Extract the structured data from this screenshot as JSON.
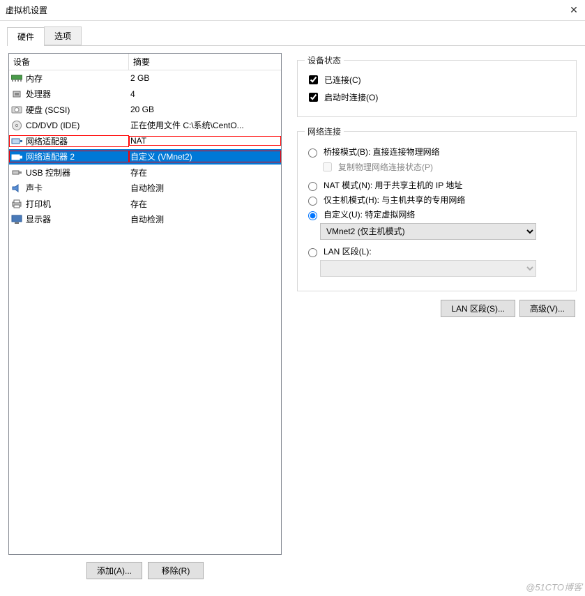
{
  "window": {
    "title": "虚拟机设置",
    "close": "✕"
  },
  "tabs": {
    "hardware": "硬件",
    "options": "选项",
    "active": "hardware"
  },
  "table": {
    "head_device": "设备",
    "head_summary": "摘要",
    "rows": [
      {
        "id": "memory",
        "icon": "memory-icon",
        "label": "内存",
        "summary": "2 GB",
        "selected": false,
        "red": false
      },
      {
        "id": "cpu",
        "icon": "cpu-icon",
        "label": "处理器",
        "summary": "4",
        "selected": false,
        "red": false
      },
      {
        "id": "hdd",
        "icon": "hdd-icon",
        "label": "硬盘 (SCSI)",
        "summary": "20 GB",
        "selected": false,
        "red": false
      },
      {
        "id": "cd",
        "icon": "cd-icon",
        "label": "CD/DVD (IDE)",
        "summary": "正在使用文件 C:\\系统\\CentO...",
        "selected": false,
        "red": false
      },
      {
        "id": "net1",
        "icon": "net-icon",
        "label": "网络适配器",
        "summary": "NAT",
        "selected": false,
        "red": true
      },
      {
        "id": "net2",
        "icon": "net-icon",
        "label": "网络适配器 2",
        "summary": "自定义 (VMnet2)",
        "selected": true,
        "red": true
      },
      {
        "id": "usb",
        "icon": "usb-icon",
        "label": "USB 控制器",
        "summary": "存在",
        "selected": false,
        "red": false
      },
      {
        "id": "sound",
        "icon": "sound-icon",
        "label": "声卡",
        "summary": "自动检测",
        "selected": false,
        "red": false
      },
      {
        "id": "printer",
        "icon": "printer-icon",
        "label": "打印机",
        "summary": "存在",
        "selected": false,
        "red": false
      },
      {
        "id": "display",
        "icon": "display-icon",
        "label": "显示器",
        "summary": "自动检测",
        "selected": false,
        "red": false
      }
    ]
  },
  "left_buttons": {
    "add": "添加(A)...",
    "remove": "移除(R)"
  },
  "device_status": {
    "legend": "设备状态",
    "connected_label": "已连接(C)",
    "connected_checked": true,
    "on_poweron_label": "启动时连接(O)",
    "on_poweron_checked": true
  },
  "net_conn": {
    "legend": "网络连接",
    "bridged": {
      "label": "桥接模式(B): 直接连接物理网络",
      "selected": false
    },
    "replicate_cb": {
      "label": "复制物理网络连接状态(P)",
      "checked": false,
      "enabled": false
    },
    "nat": {
      "label": "NAT 模式(N): 用于共享主机的 IP 地址",
      "selected": false
    },
    "hostonly": {
      "label": "仅主机模式(H): 与主机共享的专用网络",
      "selected": false
    },
    "custom": {
      "label": "自定义(U): 特定虚拟网络",
      "selected": true
    },
    "custom_combo_value": "VMnet2 (仅主机模式)",
    "lan": {
      "label": "LAN 区段(L):",
      "selected": false
    },
    "lan_combo_value": ""
  },
  "right_buttons": {
    "lan_segments": "LAN 区段(S)...",
    "advanced": "高级(V)..."
  },
  "watermark": "@51CTO博客"
}
